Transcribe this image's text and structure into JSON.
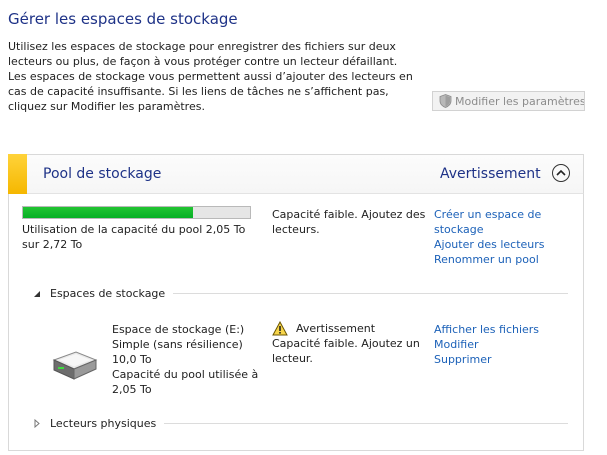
{
  "page": {
    "title": "Gérer les espaces de stockage",
    "intro": "Utilisez les espaces de stockage pour enregistrer des fichiers sur deux lecteurs ou plus, de façon à vous protéger contre un lecteur défaillant. Les espaces de stockage vous permettent aussi d’ajouter des lecteurs en cas de capacité insuffisante. Si les liens de tâches ne s’affichent pas, cliquez sur Modifier les paramètres.",
    "modify_settings_label": "Modifier les paramètres"
  },
  "pool": {
    "title": "Pool de stockage",
    "status": "Avertissement",
    "usage_percent": 0.75,
    "usage_text": "Utilisation de la capacité du pool 2,05 To sur 2,72 To",
    "warning_text": "Capacité faible. Ajoutez des lecteurs.",
    "links": [
      "Créer un espace de stockage",
      "Ajouter des lecteurs",
      "Renommer un pool"
    ]
  },
  "storage_spaces": {
    "section_label": "Espaces de stockage",
    "items": [
      {
        "name": "Espace de stockage (E:)",
        "type": "Simple (sans résilience)",
        "size": "10,0 To",
        "pool_usage": "Capacité du pool utilisée à 2,05 To",
        "status_title": "Avertissement",
        "status_text": "Capacité faible. Ajoutez un lecteur.",
        "links": [
          "Afficher les fichiers",
          "Modifier",
          "Supprimer"
        ]
      }
    ]
  },
  "physical_drives": {
    "section_label": "Lecteurs physiques"
  },
  "colors": {
    "title_blue": "#1e3287",
    "link_blue": "#1c61b8",
    "accent_yellow": "#f5b700",
    "progress_green": "#06b025"
  },
  "icons": [
    "uac-shield-icon",
    "collapse-chevron-up-icon",
    "warning-icon",
    "drive-icon",
    "expand-triangle-icon",
    "collapsed-triangle-icon"
  ]
}
